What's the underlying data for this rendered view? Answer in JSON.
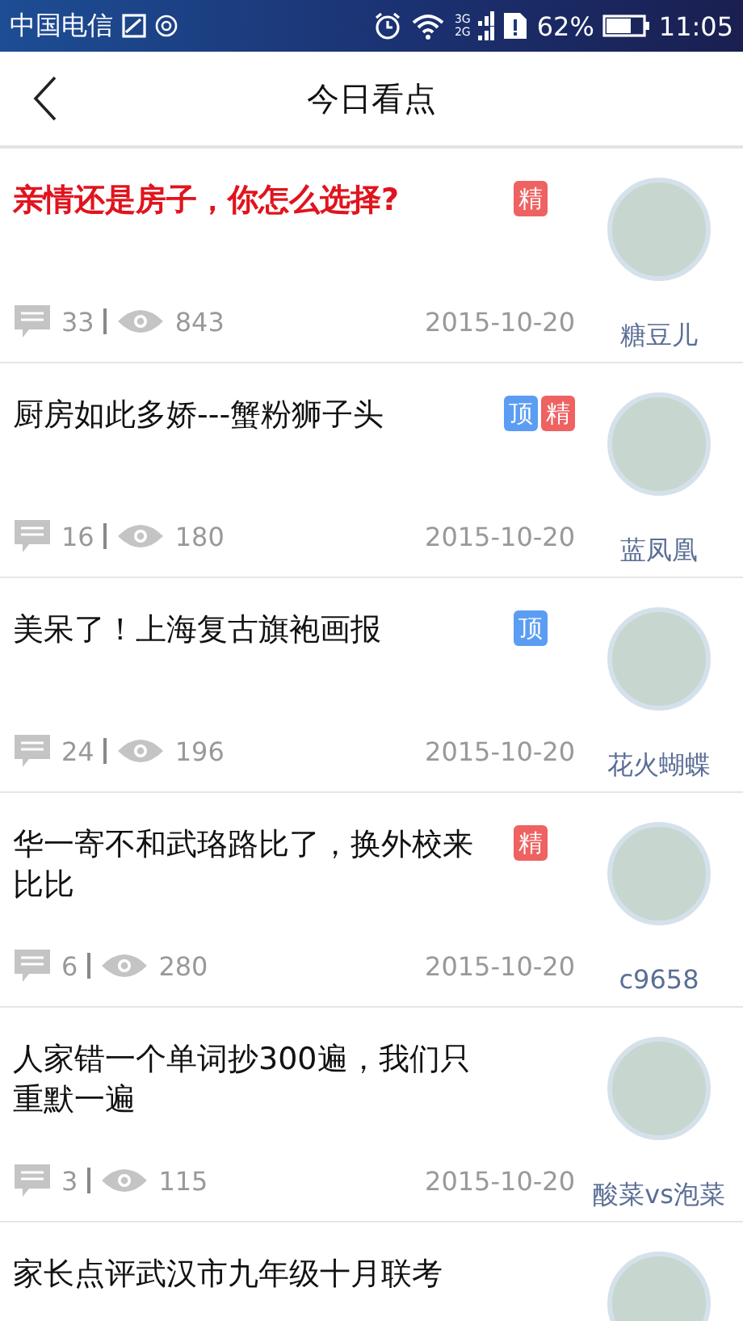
{
  "status_bar": {
    "carrier": "中国电信",
    "network_3g": "3G",
    "network_2g": "2G",
    "battery": "62%",
    "time": "11:05"
  },
  "header": {
    "title": "今日看点"
  },
  "posts": [
    {
      "title": "亲情还是房子，你怎么选择?",
      "highlighted": true,
      "badges": [
        {
          "text": "精",
          "kind": "essence"
        }
      ],
      "comments": "33",
      "views": "843",
      "date": "2015-10-20",
      "author": "糖豆儿"
    },
    {
      "title": "厨房如此多娇---蟹粉狮子头",
      "highlighted": false,
      "badges": [
        {
          "text": "顶",
          "kind": "top"
        },
        {
          "text": "精",
          "kind": "essence"
        }
      ],
      "comments": "16",
      "views": "180",
      "date": "2015-10-20",
      "author": "蓝凤凰"
    },
    {
      "title": "美呆了！上海复古旗袍画报",
      "highlighted": false,
      "badges": [
        {
          "text": "顶",
          "kind": "top"
        }
      ],
      "comments": "24",
      "views": "196",
      "date": "2015-10-20",
      "author": "花火蝴蝶"
    },
    {
      "title": "华一寄不和武珞路比了，换外校来比比",
      "highlighted": false,
      "badges": [
        {
          "text": "精",
          "kind": "essence"
        }
      ],
      "comments": "6",
      "views": "280",
      "date": "2015-10-20",
      "author": "c9658"
    },
    {
      "title": "人家错一个单词抄300遍，我们只重默一遍",
      "highlighted": false,
      "comments": "3",
      "views": "115",
      "date": "2015-10-20",
      "author": "酸菜vs泡菜"
    },
    {
      "title": "家长点评武汉市九年级十月联考",
      "highlighted": false
    }
  ]
}
